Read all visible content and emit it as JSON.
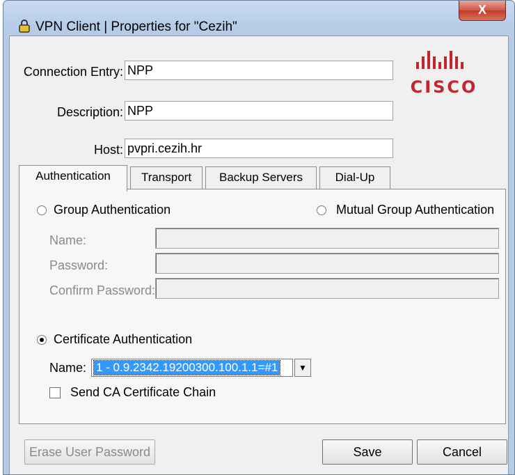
{
  "window": {
    "title": "VPN Client  |  Properties for \"Cezih\"",
    "close_label": "X"
  },
  "connection": {
    "entry_label": "Connection Entry:",
    "entry_value": "NPP",
    "description_label": "Description:",
    "description_value": "NPP",
    "host_label": "Host:",
    "host_value": "pvpri.cezih.hr"
  },
  "logo": {
    "text": "CISCO",
    "color": "#c1272d"
  },
  "tabs": [
    {
      "label": "Authentication",
      "active": true
    },
    {
      "label": "Transport"
    },
    {
      "label": "Backup Servers"
    },
    {
      "label": "Dial-Up"
    }
  ],
  "auth": {
    "group_label": "Group Authentication",
    "mutual_label": "Mutual Group Authentication",
    "name_label": "Name:",
    "password_label": "Password:",
    "confirm_label": "Confirm Password:",
    "cert_label": "Certificate Authentication",
    "cert_name_label": "Name:",
    "cert_name_value": "1 - 0.9.2342.19200300.100.1.1=#1",
    "send_ca_label": "Send CA Certificate Chain",
    "selected": "Certificate Authentication",
    "send_ca_checked": false
  },
  "buttons": {
    "erase": "Erase User Password",
    "save": "Save",
    "cancel": "Cancel"
  }
}
